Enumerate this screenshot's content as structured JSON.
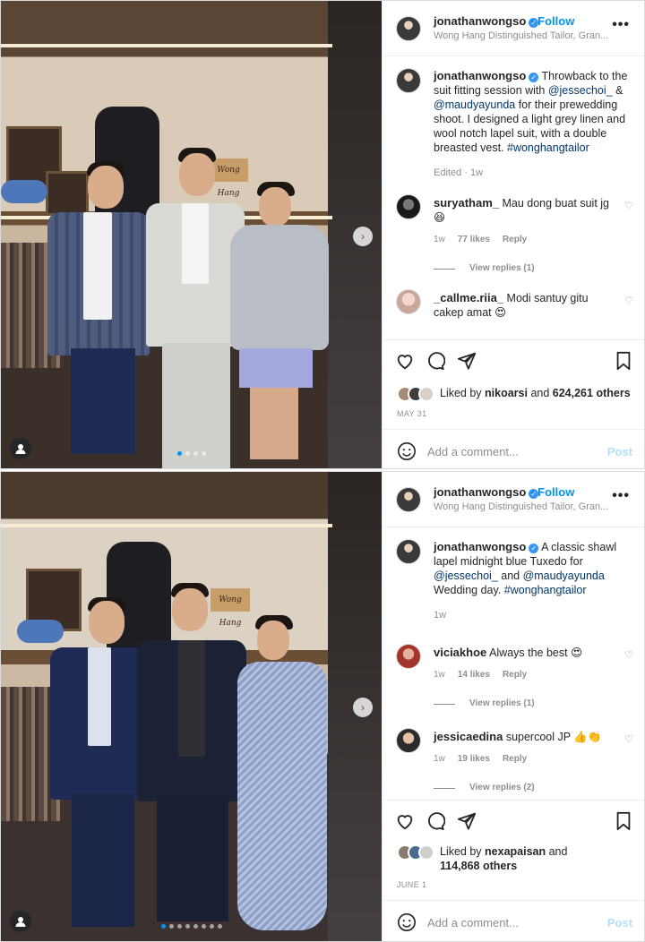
{
  "post1": {
    "username": "jonathanwongso",
    "follow_label": "Follow",
    "location": "Wong Hang Distinguished Tailor, Gran...",
    "more_label": "•••",
    "shop_sign": "Wong Hang",
    "caption": {
      "username": "jonathanwongso",
      "text_a": " Throwback to the suit fitting session with ",
      "mention1": "@jessechoi_",
      "text_b": " & ",
      "mention2": "@maudyayunda",
      "text_c": " for their prewedding shoot. I designed a light grey linen and wool notch lapel suit, with a double breasted vest. ",
      "hashtag": "#wonghangtailor",
      "meta": "Edited · 1w"
    },
    "comments": [
      {
        "username": "suryatham_",
        "text": "Mau dong buat suit jg",
        "emoji": "😆",
        "age": "1w",
        "likes": "77 likes",
        "reply": "Reply",
        "view_replies": "View replies (1)"
      },
      {
        "username": "_callme.riia_",
        "text": "Modi santuy gitu cakep amat",
        "emoji": "😍"
      }
    ],
    "liked_by_prefix": "Liked by ",
    "liked_by_user": "nikoarsi",
    "liked_by_suffix": " and ",
    "liked_by_count": "624,261 others",
    "date": "MAY 31",
    "add_comment_placeholder": "Add a comment...",
    "post_button": "Post"
  },
  "post2": {
    "username": "jonathanwongso",
    "follow_label": "Follow",
    "location": "Wong Hang Distinguished Tailor, Gran...",
    "more_label": "•••",
    "shop_sign": "Wong Hang",
    "caption": {
      "username": "jonathanwongso",
      "text_a": " A classic shawl lapel midnight blue Tuxedo for ",
      "mention1": "@jessechoi_",
      "text_b": " and ",
      "mention2": "@maudyayunda",
      "text_c": " Wedding day. ",
      "hashtag": "#wonghangtailor",
      "meta": "1w"
    },
    "comments": [
      {
        "username": "viciakhoe",
        "text": "Always the best",
        "emoji": "😍",
        "age": "1w",
        "likes": "14 likes",
        "reply": "Reply",
        "view_replies": "View replies (1)"
      },
      {
        "username": "jessicaedina",
        "text": "supercool JP",
        "emoji": "👍👏",
        "age": "1w",
        "likes": "19 likes",
        "reply": "Reply",
        "view_replies": "View replies (2)"
      }
    ],
    "liked_by_prefix": "Liked by ",
    "liked_by_user": "nexapaisan",
    "liked_by_suffix": " and",
    "liked_by_count": "114,868 others",
    "date": "JUNE 1",
    "add_comment_placeholder": "Add a comment...",
    "post_button": "Post"
  },
  "colors": {
    "accent": "#0095f6",
    "mention": "#00376b",
    "muted": "#8e8e8e",
    "verified": "#3897f0"
  }
}
